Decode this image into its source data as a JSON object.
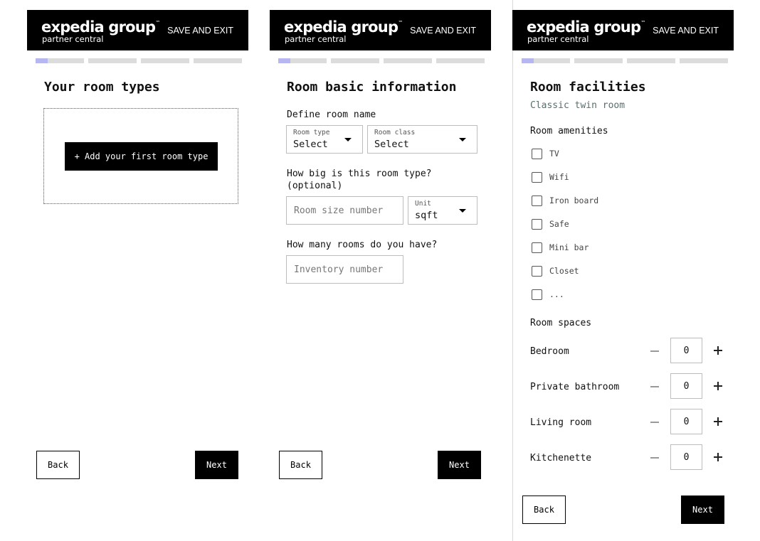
{
  "brand": {
    "logo_main": "expedia group",
    "logo_tm": "™",
    "logo_sub": "partner central"
  },
  "header": {
    "save_exit": "SAVE AND EXIT"
  },
  "progress": {
    "steps": 4,
    "current_step": 1,
    "current_fill_fraction": 0.25
  },
  "colors": {
    "header_bg": "#000000",
    "progress_active": "#b7b7ef",
    "progress_inactive": "#dcdcdc"
  },
  "screen1": {
    "title": "Your room types",
    "add_button": "+ Add your first room type",
    "back": "Back",
    "next": "Next"
  },
  "screen2": {
    "title": "Room basic information",
    "define_label": "Define room name",
    "room_type": {
      "label": "Room type",
      "value": "Select"
    },
    "room_class": {
      "label": "Room class",
      "value": "Select"
    },
    "size_question_line1": "How big is this room type?",
    "size_question_line2": "(optional)",
    "size_placeholder": "Room size number",
    "unit": {
      "label": "Unit",
      "value": "sqft"
    },
    "count_question": "How many rooms do you have?",
    "inventory_placeholder": "Inventory number",
    "back": "Back",
    "next": "Next"
  },
  "screen3": {
    "title": "Room facilities",
    "subtitle": "Classic twin room",
    "amenities_label": "Room amenities",
    "amenities": [
      "TV",
      "Wifi",
      "Iron board",
      "Safe",
      "Mini bar",
      "Closet",
      "..."
    ],
    "spaces_label": "Room spaces",
    "spaces": [
      {
        "label": "Bedroom",
        "count": "0"
      },
      {
        "label": "Private bathroom",
        "count": "0"
      },
      {
        "label": "Living room",
        "count": "0"
      },
      {
        "label": "Kitchenette",
        "count": "0"
      }
    ],
    "back": "Back",
    "next": "Next"
  }
}
